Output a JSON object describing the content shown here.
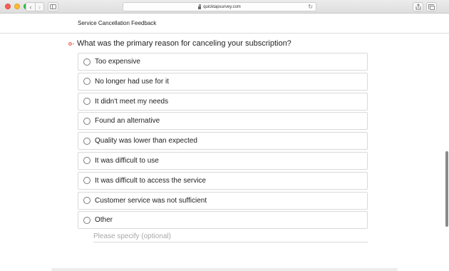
{
  "browser": {
    "url": "quicktapsurvey.com",
    "icons": {
      "back": "chevron-left-icon",
      "forward": "chevron-right-icon",
      "sidebar": "sidebar-icon",
      "lock": "lock-icon",
      "reload": "reload-icon",
      "share": "share-icon",
      "tabs": "tabs-icon"
    }
  },
  "page": {
    "title": "Service Cancellation Feedback"
  },
  "question": {
    "text": "What was the primary reason for canceling your subscription?",
    "required_marker_color": "#e36a5f",
    "options": [
      {
        "label": "Too expensive"
      },
      {
        "label": "No longer had use for it"
      },
      {
        "label": "It didn't meet my needs"
      },
      {
        "label": "Found an alternative"
      },
      {
        "label": "Quality was lower than expected"
      },
      {
        "label": "It was difficult to use"
      },
      {
        "label": "It was difficult to access the service"
      },
      {
        "label": "Customer service was not sufficient"
      },
      {
        "label": "Other"
      }
    ],
    "specify": {
      "value": "",
      "placeholder": "Please specify (optional)"
    }
  }
}
